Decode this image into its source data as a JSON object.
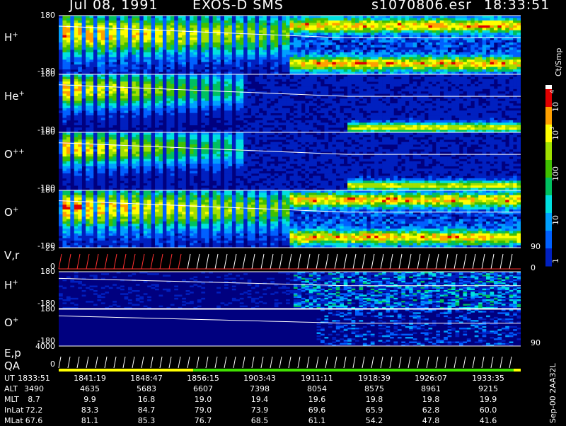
{
  "header": {
    "date": "Jul 08, 1991",
    "instrument": "EXOS-D SMS",
    "file": "s1070806.esr",
    "time": "18:33:51"
  },
  "colors": {
    "bg": "#000000",
    "low": "#00007f",
    "mid": "#00a0ff",
    "green": "#40c000",
    "yellow": "#ffff00",
    "red": "#e00000",
    "trace": "#ffffff"
  },
  "panels": [
    {
      "id": "h-plus",
      "label": "H",
      "sup": "+",
      "top": "180",
      "bottom": "-180"
    },
    {
      "id": "he-plus",
      "label": "He",
      "sup": "+",
      "top": "180",
      "bottom": "-180"
    },
    {
      "id": "o-pp",
      "label": "O",
      "sup": "++",
      "top": "180",
      "bottom": "-180"
    },
    {
      "id": "o-plus",
      "label": "O",
      "sup": "+",
      "top": "180",
      "bottom": "-180"
    }
  ],
  "vr": {
    "label": "V,r",
    "top": "25",
    "bottom": "0",
    "right_top": "90",
    "right_bottom": "0"
  },
  "panels_low": [
    {
      "id": "h-plus-2",
      "label": "H",
      "sup": "+",
      "top": "180",
      "bottom": "-180"
    },
    {
      "id": "o-plus-2",
      "label": "O",
      "sup": "+",
      "top": "180",
      "bottom": "-180",
      "right_bottom": "90"
    }
  ],
  "ep": {
    "label1": "E,p",
    "label2": "QA",
    "top": "4000",
    "bottom": "0"
  },
  "colorbar": {
    "title": "Ct/Smp",
    "ticks": [
      "10",
      "4",
      "10",
      "3",
      "100",
      "10",
      "1"
    ]
  },
  "footer_side": "Sep-00 2AA32L",
  "chart_data": {
    "type": "heatmap",
    "title": "Jul 08, 1991  EXOS-D SMS",
    "y_range": [
      -180,
      180
    ],
    "colorbar_scale": "log",
    "ut": [
      "1833:51",
      "1841:19",
      "1848:47",
      "1856:15",
      "1903:43",
      "1911:11",
      "1918:39",
      "1926:07",
      "1933:35"
    ],
    "alt": [
      "3490",
      "4635",
      "5683",
      "6607",
      "7398",
      "8054",
      "8575",
      "8961",
      "9215"
    ],
    "mlt": [
      "8.7",
      "9.9",
      "16.8",
      "19.0",
      "19.4",
      "19.6",
      "19.8",
      "19.8",
      "19.9"
    ],
    "inlat": [
      "72.2",
      "83.3",
      "84.7",
      "79.0",
      "73.9",
      "69.6",
      "65.9",
      "62.8",
      "60.0"
    ],
    "mlat": [
      "67.6",
      "81.1",
      "85.3",
      "76.7",
      "68.5",
      "61.1",
      "54.2",
      "47.8",
      "41.6"
    ]
  },
  "rows": {
    "ut": "UT",
    "alt": "ALT",
    "mlt": "MLT",
    "inlat": "InLat",
    "mlat": "MLat"
  }
}
